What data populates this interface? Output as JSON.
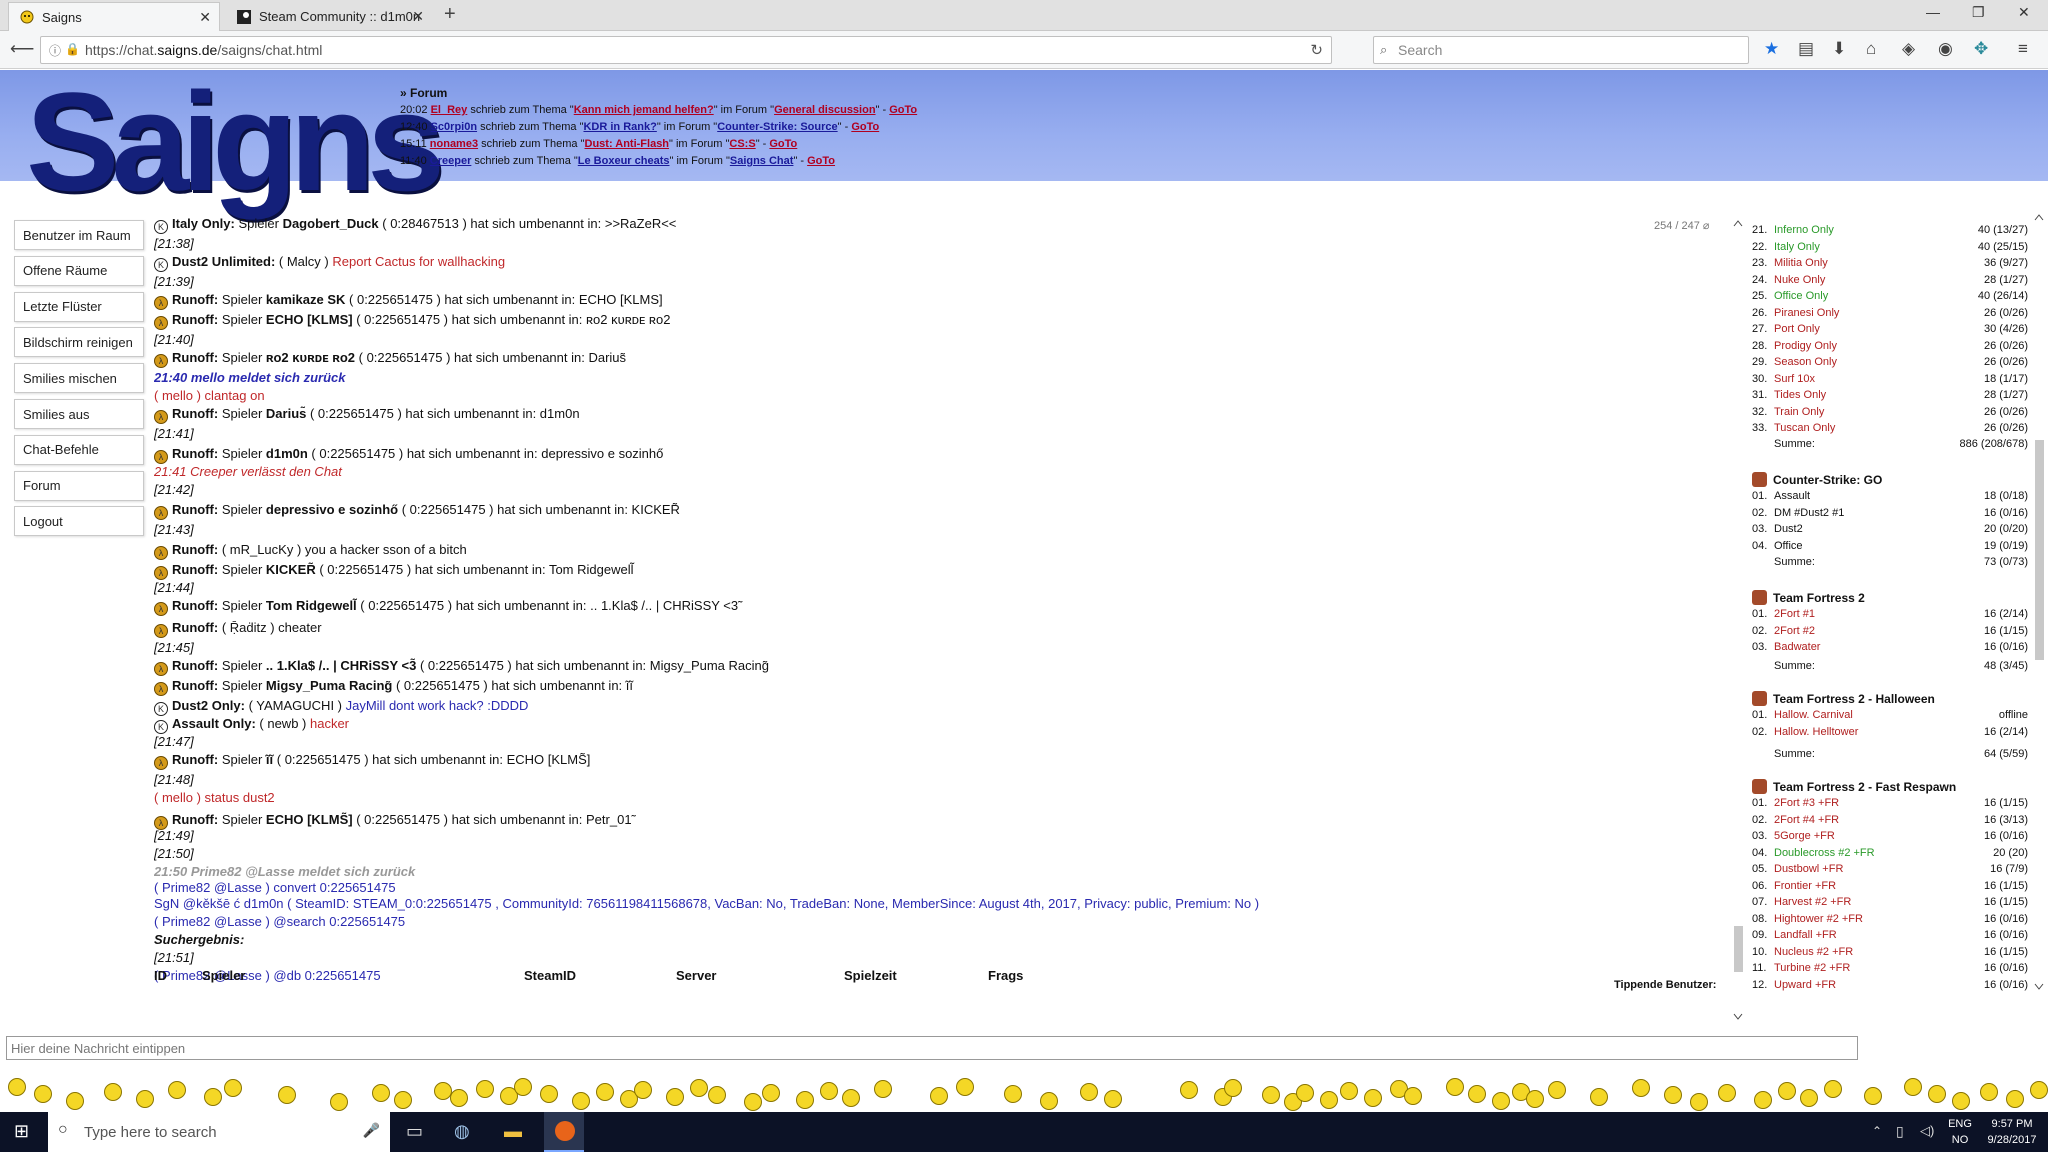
{
  "browser": {
    "tabs": [
      {
        "label": "Saigns"
      },
      {
        "label": "Steam Community :: d1m0n"
      }
    ],
    "url": {
      "prefix": "https://chat.",
      "domain": "saigns.de",
      "path": "/saigns/chat.html"
    },
    "search_placeholder": "Search"
  },
  "site": {
    "logo_text": "Saigns",
    "forum": {
      "header": "» Forum",
      "rows": [
        {
          "time": "20:02",
          "user": "El_Rey",
          "mid": " schrieb zum Thema \"",
          "topic": "Kann mich jemand helfen?",
          "mid2": "\" im Forum \"",
          "forum": "General discussion",
          "end": "\" - ",
          "goto": "GoTo",
          "user_color": "red"
        },
        {
          "time": "12:40",
          "user": "Sc0rpi0n",
          "mid": " schrieb zum Thema \"",
          "topic": "KDR in Rank?",
          "mid2": "\" im Forum \"",
          "forum": "Counter-Strike: Source",
          "end": "\" - ",
          "goto": "GoTo",
          "user_color": "blue"
        },
        {
          "time": "15:11",
          "user": "noname3",
          "mid": " schrieb zum Thema \"",
          "topic": "Dust: Anti-Flash",
          "mid2": "\" im Forum \"",
          "forum": "CS:S",
          "end": "\" - ",
          "goto": "GoTo",
          "user_color": "red"
        },
        {
          "time": "11:40",
          "user": "Creeper",
          "mid": " schrieb zum Thema \"",
          "topic": "Le Boxeur cheats",
          "mid2": "\" im Forum \"",
          "forum": "Saigns Chat",
          "end": "\" - ",
          "goto": "GoTo",
          "user_color": "blue"
        }
      ]
    }
  },
  "menu": [
    "Benutzer im Raum",
    "Offene Räume",
    "Letzte Flüster",
    "Bildschirm reinigen",
    "Smilies mischen",
    "Smilies aus",
    "Chat-Befehle",
    "Forum",
    "Logout"
  ],
  "chat": {
    "room_count": "254 / 247 ⌀",
    "lines": [
      {
        "icon": "cs",
        "bold": "Italy Only:",
        "text": " Spieler ",
        "b2": "Dagobert_Duck",
        "rest": " ( 0:28467513 ) hat sich umbenannt in: >>RaZeR<<"
      },
      {
        "ts": "[21:38]"
      },
      {
        "icon": "cs",
        "bold": "Dust2 Unlimited:",
        "text": " ( Malcy ) ",
        "red": "Report Cactus for wallhacking"
      },
      {
        "ts": "[21:39]"
      },
      {
        "icon": "hl",
        "bold": "Runoff:",
        "text": " Spieler ",
        "b2": "kamikaze SK",
        "rest": " ( 0:225651475 ) hat sich umbenannt in: ECHO [KLMS]"
      },
      {
        "icon": "hl",
        "bold": "Runoff:",
        "text": " Spieler ",
        "b2": "ECHO [KLMS]",
        "rest": " ( 0:225651475 ) hat sich umbenannt in: ʀᴏ2 ĸᴜʀᴅᴇ ʀᴏ2"
      },
      {
        "ts": "[21:40]"
      },
      {
        "icon": "hl",
        "bold": "Runoff:",
        "text": " Spieler ",
        "b2": "ʀᴏ2 ĸᴜʀᴅᴇ ʀᴏ2",
        "rest": " ( 0:225651475 ) hat sich umbenannt in: Darius̃"
      },
      {
        "back": "21:40 mello meldet sich zurück"
      },
      {
        "plain": "( mello ) clantag on",
        "mellorow": true
      },
      {
        "icon": "hl",
        "bold": "Runoff:",
        "text": " Spieler ",
        "b2": "Darius̃",
        "rest": " ( 0:225651475 ) hat sich umbenannt in: d1m0n"
      },
      {
        "ts": "[21:41]"
      },
      {
        "icon": "hl",
        "bold": "Runoff:",
        "text": " Spieler ",
        "b2": "d1m0n",
        "rest": " ( 0:225651475 ) hat sich umbenannt in: depressivo e sozinhő"
      },
      {
        "leave": "21:41 Creeper verlässt den Chat"
      },
      {
        "ts": "[21:42]"
      },
      {
        "icon": "hl",
        "bold": "Runoff:",
        "text": " Spieler ",
        "b2": "depressivo e sozinhő",
        "rest": " ( 0:225651475 ) hat sich umbenannt in: KICKER̃"
      },
      {
        "ts": "[21:43]"
      },
      {
        "icon": "hl",
        "bold": "Runoff:",
        "text": " ( mR_LucKy ) you a hacker sson of a bitch"
      },
      {
        "icon": "hl",
        "bold": "Runoff:",
        "text": " Spieler ",
        "b2": "KICKER̃",
        "rest": " ( 0:225651475 ) hat sich umbenannt in: Tom Ridgewell̃"
      },
      {
        "ts": "[21:44]"
      },
      {
        "icon": "hl",
        "bold": "Runoff:",
        "text": " Spieler ",
        "b2": "Tom Ridgewell̃",
        "rest": " ( 0:225651475 ) hat sich umbenannt in: .. 1.Kla$ /.. | CHRiSSY <3̃"
      },
      {
        "icon": "hl",
        "bold": "Runoff:",
        "text": " ( Ṝaḋitz ) cheater"
      },
      {
        "ts": "[21:45]"
      },
      {
        "icon": "hl",
        "bold": "Runoff:",
        "text": " Spieler ",
        "b2": ".. 1.Kla$ /.. | CHRiSSY <3̃",
        "rest": " ( 0:225651475 ) hat sich umbenannt in: Migsy_Puma Racing̃"
      },
      {
        "icon": "hl",
        "bold": "Runoff:",
        "text": " Spieler ",
        "b2": "Migsy_Puma Racing̃",
        "rest": " ( 0:225651475 ) hat sich umbenannt in: ĩĩ"
      },
      {
        "icon": "cs",
        "bold": "Dust2 Only:",
        "text": " ( YAMAGUCHI ) ",
        "blue": "JayMill dont work hack? :DDDD"
      },
      {
        "icon": "cs",
        "bold": "Assault Only:",
        "text": " ( newb ) ",
        "red": "hacker"
      },
      {
        "ts": "[21:47]"
      },
      {
        "icon": "hl",
        "bold": "Runoff:",
        "text": " Spieler ",
        "b2": "ĩĩ",
        "rest": " ( 0:225651475 ) hat sich umbenannt in: ECHO [KLMS̃]"
      },
      {
        "ts": "[21:48]"
      },
      {
        "plain": "( mello ) status dust2",
        "mellorow": true
      },
      {
        "icon": "hl",
        "bold": "Runoff:",
        "text": " Spieler ",
        "b2": "ECHO [KLMS̃]",
        "rest": " ( 0:225651475 ) hat sich umbenannt in: Petr_01̃"
      },
      {
        "ts": "[21:49]"
      },
      {
        "ts": "[21:50]"
      },
      {
        "backgrey": "21:50 Prime82 @Lasse meldet sich zurück"
      },
      {
        "bluecmd": "( Prime82 @Lasse ) convert 0:225651475"
      },
      {
        "steam": "SgN @kěkšē ć  d1m0n ( SteamID: STEAM_0:0:225651475 , CommunityId: 76561198411568678, VacBan: No, TradeBan: None, MemberSince: August 4th, 2017, Privacy: public, Premium: No )"
      },
      {
        "bluecmd": "( Prime82 @Lasse ) @search 0:225651475"
      },
      {
        "result": "Suchergebnis:"
      },
      {
        "ts": "[21:51]"
      },
      {
        "bluecmd": "( Prime82 @Lasse ) @db 0:225651475"
      }
    ],
    "result_headers": [
      "ID",
      "Spieler",
      "SteamID",
      "Server",
      "Spielzeit",
      "Frags"
    ],
    "tippende": "Tippende Benutzer:"
  },
  "servers": {
    "rows1": [
      {
        "n": "21.",
        "name": "Inferno Only",
        "v": "40 (13/27)",
        "c": "g"
      },
      {
        "n": "22.",
        "name": "Italy Only",
        "v": "40 (25/15)",
        "c": "g"
      },
      {
        "n": "23.",
        "name": "Militia Only",
        "v": "36 (9/27)",
        "c": "r"
      },
      {
        "n": "24.",
        "name": "Nuke Only",
        "v": "28 (1/27)",
        "c": "r"
      },
      {
        "n": "25.",
        "name": "Office Only",
        "v": "40 (26/14)",
        "c": "g"
      },
      {
        "n": "26.",
        "name": "Piranesi Only",
        "v": "26 (0/26)",
        "c": "r"
      },
      {
        "n": "27.",
        "name": "Port Only",
        "v": "30 (4/26)",
        "c": "r"
      },
      {
        "n": "28.",
        "name": "Prodigy Only",
        "v": "26 (0/26)",
        "c": "r"
      },
      {
        "n": "29.",
        "name": "Season Only",
        "v": "26 (0/26)",
        "c": "r"
      },
      {
        "n": "30.",
        "name": "Surf 10x",
        "v": "18 (1/17)",
        "c": "r"
      },
      {
        "n": "31.",
        "name": "Tides Only",
        "v": "28 (1/27)",
        "c": "r"
      },
      {
        "n": "32.",
        "name": "Train Only",
        "v": "26 (0/26)",
        "c": "r"
      },
      {
        "n": "33.",
        "name": "Tuscan Only",
        "v": "26 (0/26)",
        "c": "r"
      }
    ],
    "summe_label": "Summe:",
    "summe1": "886 (208/678)",
    "group_csgo": "Counter-Strike: GO",
    "rows_csgo": [
      {
        "n": "01.",
        "name": "Assault",
        "v": "18 (0/18)",
        "c": "k"
      },
      {
        "n": "02.",
        "name": "DM #Dust2 #1",
        "v": "16 (0/16)",
        "c": "k"
      },
      {
        "n": "03.",
        "name": "Dust2",
        "v": "20 (0/20)",
        "c": "k"
      },
      {
        "n": "04.",
        "name": "Office",
        "v": "19 (0/19)",
        "c": "k"
      }
    ],
    "summe_csgo": "73 (0/73)",
    "group_tf2": "Team Fortress 2",
    "rows_tf2": [
      {
        "n": "01.",
        "name": "2Fort #1",
        "v": "16 (2/14)",
        "c": "r"
      },
      {
        "n": "02.",
        "name": "2Fort #2",
        "v": "16 (1/15)",
        "c": "r"
      },
      {
        "n": "03.",
        "name": "Badwater",
        "v": "16 (0/16)",
        "c": "r"
      }
    ],
    "summe_tf2": "48 (3/45)",
    "group_halloween": "Team Fortress 2 - Halloween",
    "rows_halloween": [
      {
        "n": "01.",
        "name": "Hallow. Carnival",
        "v": "offline",
        "c": "r"
      },
      {
        "n": "02.",
        "name": "Hallow. Helltower",
        "v": "16 (2/14)",
        "c": "r"
      }
    ],
    "summe_halloween": "64 (5/59)",
    "group_fast": "Team Fortress 2 - Fast Respawn",
    "rows_fast": [
      {
        "n": "01.",
        "name": "2Fort #3 +FR",
        "v": "16 (1/15)",
        "c": "r"
      },
      {
        "n": "02.",
        "name": "2Fort #4 +FR",
        "v": "16 (3/13)",
        "c": "r"
      },
      {
        "n": "03.",
        "name": "5Gorge +FR",
        "v": "16 (0/16)",
        "c": "r"
      },
      {
        "n": "04.",
        "name": "Doublecross #2 +FR",
        "v": "20 (20)",
        "c": "g"
      },
      {
        "n": "05.",
        "name": "Dustbowl +FR",
        "v": "16 (7/9)",
        "c": "r"
      },
      {
        "n": "06.",
        "name": "Frontier +FR",
        "v": "16 (1/15)",
        "c": "r"
      },
      {
        "n": "07.",
        "name": "Harvest #2 +FR",
        "v": "16 (1/15)",
        "c": "r"
      },
      {
        "n": "08.",
        "name": "Hightower #2 +FR",
        "v": "16 (0/16)",
        "c": "r"
      },
      {
        "n": "09.",
        "name": "Landfall +FR",
        "v": "16 (0/16)",
        "c": "r"
      },
      {
        "n": "10.",
        "name": "Nucleus #2 +FR",
        "v": "16 (1/15)",
        "c": "r"
      },
      {
        "n": "11.",
        "name": "Turbine #2 +FR",
        "v": "16 (0/16)",
        "c": "r"
      },
      {
        "n": "12.",
        "name": "Upward +FR",
        "v": "16 (0/16)",
        "c": "r"
      }
    ]
  },
  "input": {
    "placeholder": "Hier deine Nachricht eintippen"
  },
  "taskbar": {
    "search_placeholder": "Type here to search",
    "lang1": "ENG",
    "lang2": "NO",
    "time": "9:57 PM",
    "date": "9/28/2017"
  },
  "colors": {
    "header_blue": "#8aa2ec",
    "logo": "#14207a",
    "link_red": "#b00020",
    "green": "#2a9a2a",
    "red": "#b02020"
  }
}
